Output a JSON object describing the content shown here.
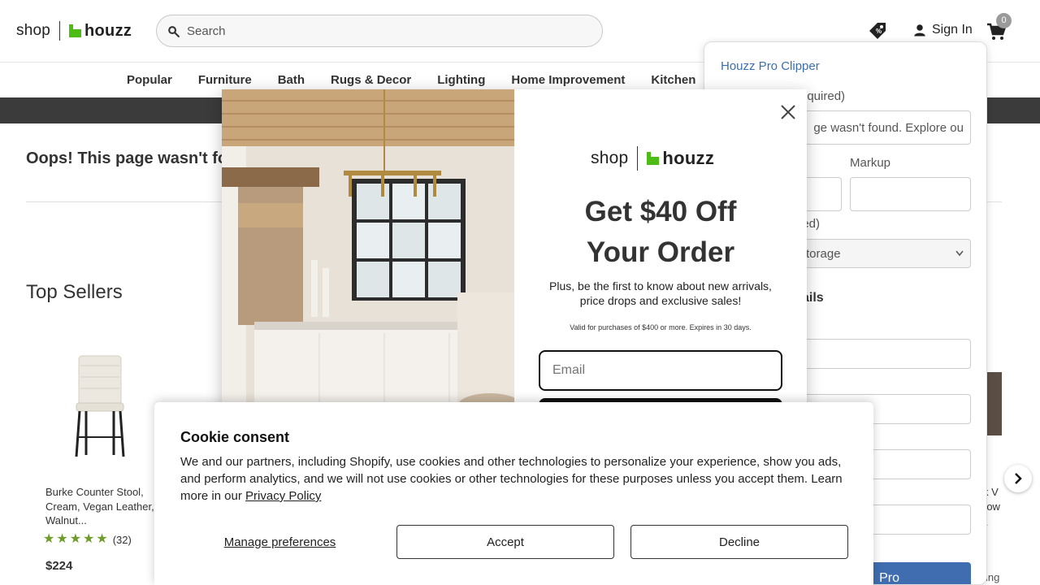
{
  "header": {
    "logo_shop": "shop",
    "logo_brand": "houzz",
    "search_placeholder": "Search",
    "sign_in": "Sign In",
    "cart_count": "0"
  },
  "nav": {
    "items": [
      "Popular",
      "Furniture",
      "Bath",
      "Rugs & Decor",
      "Lighting",
      "Home Improvement",
      "Kitchen"
    ]
  },
  "main": {
    "oops_text": "Oops! This page wasn't fou",
    "section_title": "Top Sellers",
    "product": {
      "title": "Burke Counter Stool, Cream, Vegan Leather, Walnut...",
      "rating_count": "(32)",
      "rating": 5,
      "price": "$224"
    },
    "peek_product": {
      "title": "k V",
      "title2": "row",
      "footer": "ing"
    }
  },
  "clipper": {
    "title": "Houzz Pro Clipper",
    "label_name_tail": "equired)",
    "name_value": "ge wasn't found. Explore ou",
    "label_markup": "Markup",
    "label_category_tail": "ired)",
    "category_value": "torage",
    "heading_tail": "ails",
    "save_label_tail": "Pro"
  },
  "modal": {
    "logo_shop": "shop",
    "logo_brand": "houzz",
    "headline_line1": "Get $40 Off",
    "headline_line2": "Your Order",
    "subtext": "Plus, be the first to know about new arrivals, price drops and exclusive sales!",
    "fine_print": "Valid for purchases of $400 or more. Expires in 30 days.",
    "email_placeholder": "Email"
  },
  "cookie": {
    "title": "Cookie consent",
    "text": "We and our partners, including Shopify, use cookies and other technologies to personalize your experience, show you ads, and perform analytics, and we will not use cookies or other technologies for these purposes unless you accept them. Learn more in our ",
    "link": "Privacy Policy",
    "manage": "Manage preferences",
    "accept": "Accept",
    "decline": "Decline"
  },
  "colors": {
    "brand_green": "#4dbc15",
    "clipper_blue": "#3f6db0",
    "star_green": "#6e9c2a"
  }
}
